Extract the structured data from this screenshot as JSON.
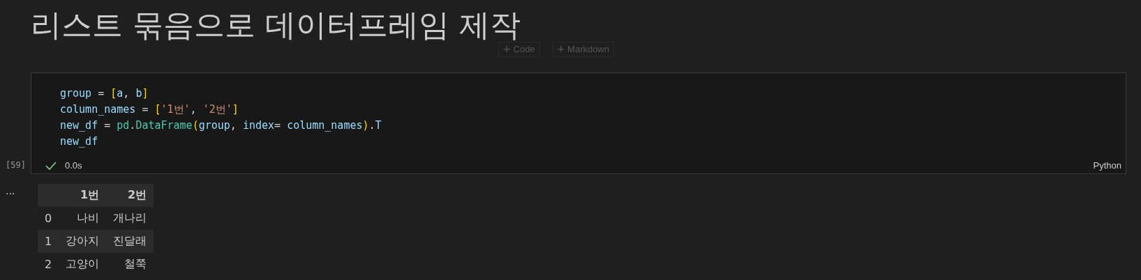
{
  "heading": "리스트 묶음으로 데이터프레임 제작",
  "insert_buttons": [
    {
      "icon": "+",
      "label": "Code"
    },
    {
      "icon": "+",
      "label": "Markdown"
    }
  ],
  "cell": {
    "execution_count": "[59]",
    "succeeded": true,
    "duration": "0.0s",
    "language": "Python",
    "code_lines": [
      [
        {
          "kind": "var",
          "text": "group"
        },
        {
          "kind": "op",
          "text": " = "
        },
        {
          "kind": "bracket",
          "text": "["
        },
        {
          "kind": "var",
          "text": "a"
        },
        {
          "kind": "op",
          "text": ", "
        },
        {
          "kind": "var",
          "text": "b"
        },
        {
          "kind": "bracket",
          "text": "]"
        }
      ],
      [
        {
          "kind": "var",
          "text": "column_names"
        },
        {
          "kind": "op",
          "text": " = "
        },
        {
          "kind": "bracket",
          "text": "["
        },
        {
          "kind": "str",
          "text": "'1번'"
        },
        {
          "kind": "op",
          "text": ", "
        },
        {
          "kind": "str",
          "text": "'2번'"
        },
        {
          "kind": "bracket",
          "text": "]"
        }
      ],
      [
        {
          "kind": "var",
          "text": "new_df"
        },
        {
          "kind": "op",
          "text": " = "
        },
        {
          "kind": "cls",
          "text": "pd"
        },
        {
          "kind": "op",
          "text": "."
        },
        {
          "kind": "cls",
          "text": "DataFrame"
        },
        {
          "kind": "bracket",
          "text": "("
        },
        {
          "kind": "var",
          "text": "group"
        },
        {
          "kind": "op",
          "text": ", "
        },
        {
          "kind": "var",
          "text": "index"
        },
        {
          "kind": "op",
          "text": "= "
        },
        {
          "kind": "var",
          "text": "column_names"
        },
        {
          "kind": "bracket",
          "text": ")"
        },
        {
          "kind": "op",
          "text": "."
        },
        {
          "kind": "var",
          "text": "T"
        }
      ],
      [
        {
          "kind": "var",
          "text": "new_df"
        }
      ]
    ]
  },
  "output": {
    "menu": "...",
    "table": {
      "columns": [
        "1번",
        "2번"
      ],
      "rows": [
        {
          "index": "0",
          "cells": [
            "나비",
            "개나리"
          ]
        },
        {
          "index": "1",
          "cells": [
            "강아지",
            "진달래"
          ]
        },
        {
          "index": "2",
          "cells": [
            "고양이",
            "철쭉"
          ]
        }
      ]
    }
  }
}
